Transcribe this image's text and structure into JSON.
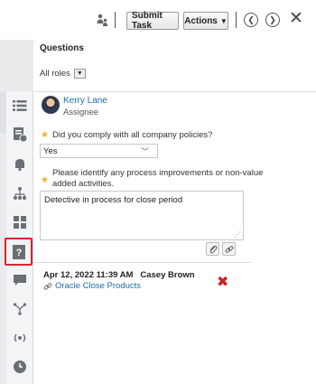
{
  "toolbar": {
    "submit_label": "Submit Task",
    "actions_label": "Actions"
  },
  "panel": {
    "title": "Questions",
    "roles_label": "All roles"
  },
  "assignee": {
    "name": "Kerry Lane",
    "role": "Assignee"
  },
  "questions": [
    {
      "text": "Did you comply with all company policies?",
      "answer": "Yes",
      "required": true
    },
    {
      "text": "Please identify any process improvements or non-value added activities.",
      "answer": "Detective in process for close period",
      "required": true
    }
  ],
  "history": {
    "entry_date": "Apr 12, 2022 11:39 AM",
    "entry_user": "Casey Brown",
    "entry_date_full": "Apr 12, 2022 11:39 AM   Casey Brown",
    "link_text": "Oracle Close Products"
  },
  "colors": {
    "accent_link": "#1a6bb3",
    "required_star": "#f0b322",
    "active_outline": "#d9262e",
    "delete": "#cc1f1f"
  },
  "rail_icons": [
    "list-icon",
    "document-info-icon",
    "bell-icon",
    "hierarchy-icon",
    "grid-split-icon",
    "question-icon",
    "comment-icon",
    "workflow-icon",
    "broadcast-icon",
    "clock-icon"
  ]
}
